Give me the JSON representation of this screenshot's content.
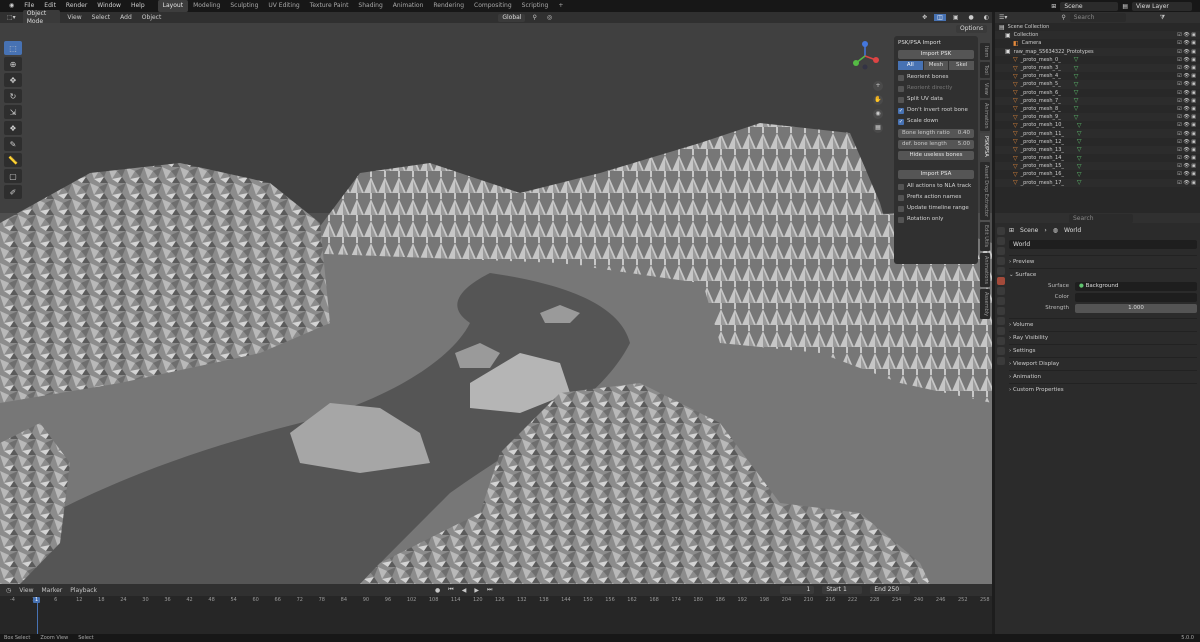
{
  "menubar": {
    "items": [
      "File",
      "Edit",
      "Render",
      "Window",
      "Help"
    ]
  },
  "workspaces": [
    {
      "label": "Layout",
      "active": true
    },
    {
      "label": "Modeling"
    },
    {
      "label": "Sculpting"
    },
    {
      "label": "UV Editing"
    },
    {
      "label": "Texture Paint"
    },
    {
      "label": "Shading"
    },
    {
      "label": "Animation"
    },
    {
      "label": "Rendering"
    },
    {
      "label": "Compositing"
    },
    {
      "label": "Scripting"
    }
  ],
  "scene_field": "Scene",
  "view_layer_field": "View Layer",
  "viewport_header": {
    "mode": "Object Mode",
    "menus": [
      "View",
      "Select",
      "Add",
      "Object"
    ],
    "orientation": "Global",
    "options": "Options"
  },
  "npanel": {
    "title": "PSK/PSA Import",
    "import_psk": "Import PSK",
    "filter": [
      "All",
      "Mesh",
      "Skel"
    ],
    "filter_active": "All",
    "checks": [
      {
        "label": "Reorient bones",
        "on": false,
        "dim": false
      },
      {
        "label": "Reorient directly",
        "on": false,
        "dim": true
      },
      {
        "label": "Split UV data",
        "on": false,
        "dim": false
      },
      {
        "label": "Don't invert root bone",
        "on": true,
        "dim": false
      },
      {
        "label": "Scale down",
        "on": true,
        "dim": false
      }
    ],
    "bone_ratio": {
      "label": "Bone length ratio",
      "value": "0.40"
    },
    "def_bone": {
      "label": "def. bone length",
      "value": "5.00"
    },
    "hide_unused": "Hide useless bones",
    "import_psa": "Import PSA",
    "psa_checks": [
      {
        "label": "All actions to NLA track",
        "on": false
      },
      {
        "label": "Prefix action names",
        "on": false
      },
      {
        "label": "Update timeline range",
        "on": false
      },
      {
        "label": "Rotation only",
        "on": false
      }
    ]
  },
  "side_tabs": [
    "Item",
    "Tool",
    "View",
    "Animation",
    "PSK/PSA",
    "Asset Drop Extractor",
    "Edit Utils",
    "Animations",
    "Assembly"
  ],
  "active_side_tab": "PSK/PSA",
  "timeline": {
    "menus": [
      "View",
      "Marker",
      "Playback"
    ],
    "current_frame": "1",
    "start_label": "Start",
    "start": "1",
    "end_label": "End",
    "end": "250",
    "ticks": [
      "-4",
      "1",
      "6",
      "12",
      "18",
      "24",
      "30",
      "36",
      "42",
      "48",
      "54",
      "60",
      "66",
      "72",
      "78",
      "84",
      "90",
      "96",
      "102",
      "108",
      "114",
      "120",
      "126",
      "132",
      "138",
      "144",
      "150",
      "156",
      "162",
      "168",
      "174",
      "180",
      "186",
      "192",
      "198",
      "204",
      "210",
      "216",
      "222",
      "228",
      "234",
      "240",
      "246",
      "252",
      "258"
    ]
  },
  "status": {
    "items": [
      "Box Select",
      "Zoom View",
      "Select"
    ],
    "version": "5.0.0"
  },
  "outliner": {
    "search_placeholder": "Search",
    "rows": [
      {
        "label": "Scene Collection",
        "type": "root"
      },
      {
        "label": "Collection",
        "type": "col"
      },
      {
        "label": "Camera",
        "type": "cam"
      },
      {
        "label": "raw_map_S5634322_Prototypes",
        "type": "col"
      },
      {
        "label": "_proto_mesh_0_",
        "type": "mesh"
      },
      {
        "label": "_proto_mesh_3_",
        "type": "mesh"
      },
      {
        "label": "_proto_mesh_4_",
        "type": "mesh"
      },
      {
        "label": "_proto_mesh_5_",
        "type": "mesh"
      },
      {
        "label": "_proto_mesh_6_",
        "type": "mesh"
      },
      {
        "label": "_proto_mesh_7_",
        "type": "mesh"
      },
      {
        "label": "_proto_mesh_8_",
        "type": "mesh"
      },
      {
        "label": "_proto_mesh_9_",
        "type": "mesh"
      },
      {
        "label": "_proto_mesh_10_",
        "type": "mesh"
      },
      {
        "label": "_proto_mesh_11_",
        "type": "mesh"
      },
      {
        "label": "_proto_mesh_12_",
        "type": "mesh"
      },
      {
        "label": "_proto_mesh_13_",
        "type": "mesh"
      },
      {
        "label": "_proto_mesh_14_",
        "type": "mesh"
      },
      {
        "label": "_proto_mesh_15_",
        "type": "mesh"
      },
      {
        "label": "_proto_mesh_16_",
        "type": "mesh"
      },
      {
        "label": "_proto_mesh_17_",
        "type": "mesh"
      }
    ]
  },
  "properties": {
    "search_placeholder": "Search",
    "crumb_scene": "Scene",
    "crumb_world": "World",
    "world_name": "World",
    "sections": {
      "preview": "Preview",
      "surface": "Surface",
      "volume": "Volume",
      "ray": "Ray Visibility",
      "settings": "Settings",
      "viewport": "Viewport Display",
      "animation": "Animation",
      "custom": "Custom Properties"
    },
    "surface_label": "Surface",
    "surface_value": "Background",
    "color_label": "Color",
    "strength_label": "Strength",
    "strength_value": "1.000"
  },
  "colors": {
    "accent": "#4772b3",
    "world_icon": "#a34a3a",
    "mesh_icon": "#e68a3b",
    "data_icon": "#5fc46f"
  }
}
